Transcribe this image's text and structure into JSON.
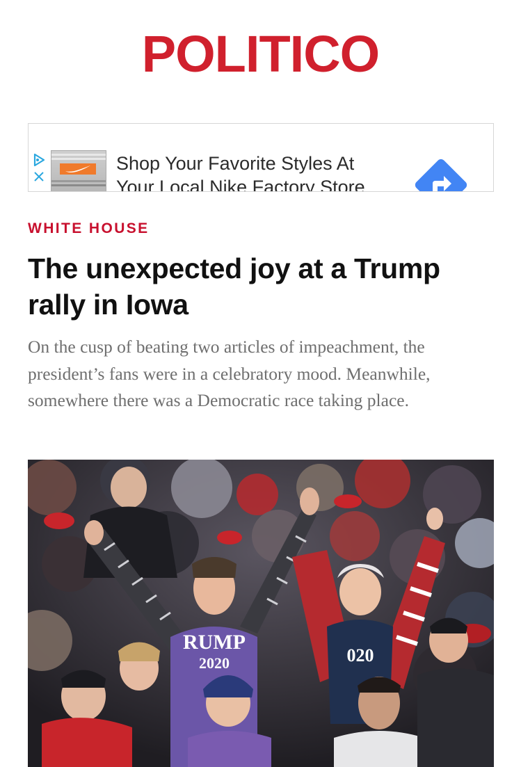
{
  "brand": {
    "logo_text": "POLITICO",
    "color": "#d0202d"
  },
  "ad": {
    "line1": "Shop Your Favorite Styles At",
    "line2": "Your Local Nike Factory Store",
    "adchoices_icon": "adchoices-triangle-icon",
    "close_icon": "close-icon",
    "cta_icon": "directions-arrow-icon",
    "cta_color": "#4285f4"
  },
  "article": {
    "section": "WHITE HOUSE",
    "section_color": "#c8102e",
    "headline": "The unexpected joy at a Trump rally in Iowa",
    "dek": "On the cusp of beating two articles of impeachment, the president’s fans were in a celebratory mood. Meanwhile, somewhere there was a Democratic race taking place."
  },
  "photo": {
    "shirt_text": "RUMP",
    "shirt_year": "2020"
  }
}
